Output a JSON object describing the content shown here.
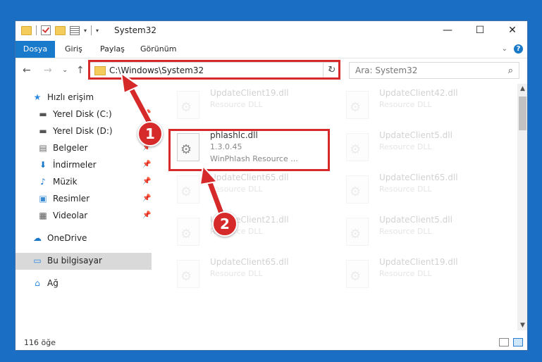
{
  "window": {
    "title": "System32",
    "minimize": "—",
    "maximize": "☐",
    "close": "✕"
  },
  "ribbon": {
    "tabs": [
      "Dosya",
      "Giriş",
      "Paylaş",
      "Görünüm"
    ],
    "help": "?",
    "collapse": "⌄"
  },
  "nav": {
    "back": "←",
    "forward": "→",
    "recent": "⌄",
    "up": "↑",
    "address": "C:\\Windows\\System32",
    "refresh": "↻",
    "search_placeholder": "Ara: System32",
    "search_glyph": "⌕"
  },
  "sidebar": {
    "items": [
      {
        "label": "Hızlı erişim",
        "icon": "★",
        "pin": ""
      },
      {
        "label": "Yerel Disk (C:)",
        "icon": "▬",
        "pin": "📌"
      },
      {
        "label": "Yerel Disk (D:)",
        "icon": "▬",
        "pin": "📌"
      },
      {
        "label": "Belgeler",
        "icon": "▤",
        "pin": "📌"
      },
      {
        "label": "İndirmeler",
        "icon": "⬇",
        "pin": "📌"
      },
      {
        "label": "Müzik",
        "icon": "♪",
        "pin": "📌"
      },
      {
        "label": "Resimler",
        "icon": "▣",
        "pin": "📌"
      },
      {
        "label": "Videolar",
        "icon": "▦",
        "pin": "📌"
      },
      {
        "label": "OneDrive",
        "icon": "☁",
        "pin": ""
      },
      {
        "label": "Bu bilgisayar",
        "icon": "▭",
        "pin": ""
      },
      {
        "label": "Ağ",
        "icon": "⌂",
        "pin": ""
      }
    ]
  },
  "files": [
    {
      "name": "UpdateClient19.dll",
      "type": "Resource DLL",
      "extra": ""
    },
    {
      "name": "UpdateClient42.dll",
      "type": "Resource DLL",
      "extra": ""
    },
    {
      "name": "phlashlc.dll",
      "type": "1.3.0.45",
      "extra": "WinPhlash Resource ..."
    },
    {
      "name": "UpdateClient5.dll",
      "type": "Resource DLL",
      "extra": ""
    },
    {
      "name": "UpdateClient65.dll",
      "type": "Resource DLL",
      "extra": ""
    },
    {
      "name": "UpdateClient65.dll",
      "type": "Resource DLL",
      "extra": ""
    },
    {
      "name": "UpdateClient21.dll",
      "type": "Resource DLL",
      "extra": ""
    },
    {
      "name": "UpdateClient5.dll",
      "type": "Resource DLL",
      "extra": ""
    },
    {
      "name": "UpdateClient65.dll",
      "type": "Resource DLL",
      "extra": ""
    },
    {
      "name": "UpdateClient19.dll",
      "type": "Resource DLL",
      "extra": ""
    }
  ],
  "status": {
    "count": "116 öğe"
  },
  "callouts": [
    "1",
    "2"
  ],
  "colors": {
    "accent": "#1979ca",
    "highlight": "#d62a2a"
  }
}
